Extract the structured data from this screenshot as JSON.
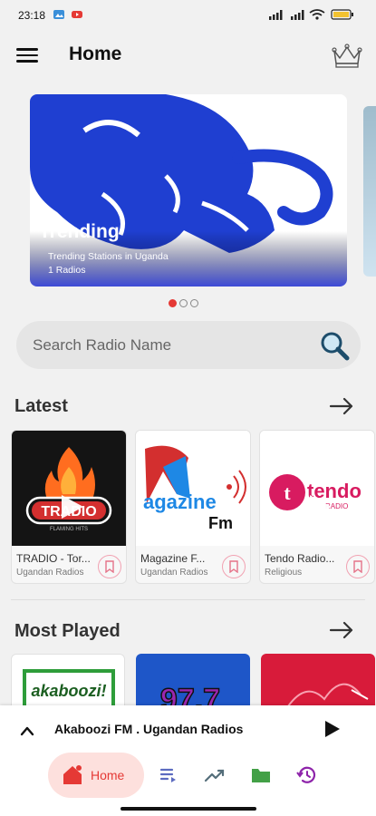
{
  "status_bar": {
    "time": "23:18"
  },
  "app_bar": {
    "title": "Home"
  },
  "banner": {
    "title": "Trending",
    "subtitle": "Trending Stations in Uganda",
    "count": "1 Radios"
  },
  "carousel": {
    "page_count": 3,
    "active_index": 0
  },
  "search": {
    "placeholder": "Search Radio Name"
  },
  "latest": {
    "title": "Latest",
    "items": [
      {
        "name": "TRADIO - Tor...",
        "category": "Ugandan Radios",
        "logo_text": "TRADIO",
        "logo_sub": "FLAMING HITS"
      },
      {
        "name": "Magazine F...",
        "category": "Ugandan Radios",
        "logo_text": "agazine",
        "logo_sub": "Fm"
      },
      {
        "name": "Tendo Radio...",
        "category": "Religious",
        "logo_text": "tendo",
        "logo_sub": "RADIO"
      }
    ]
  },
  "most_played": {
    "title": "Most Played",
    "items": [
      {
        "logo_text": "akaboozi!"
      },
      {
        "logo_text": "97.7"
      },
      {
        "logo_text": ""
      }
    ]
  },
  "player": {
    "now_playing": "Akaboozi FM . Ugandan Radios"
  },
  "bottom_nav": {
    "home_label": "Home"
  },
  "colors": {
    "accent": "#e53935",
    "banner_blue": "#1f3fd1",
    "nav_active_bg": "#fde0dd"
  }
}
